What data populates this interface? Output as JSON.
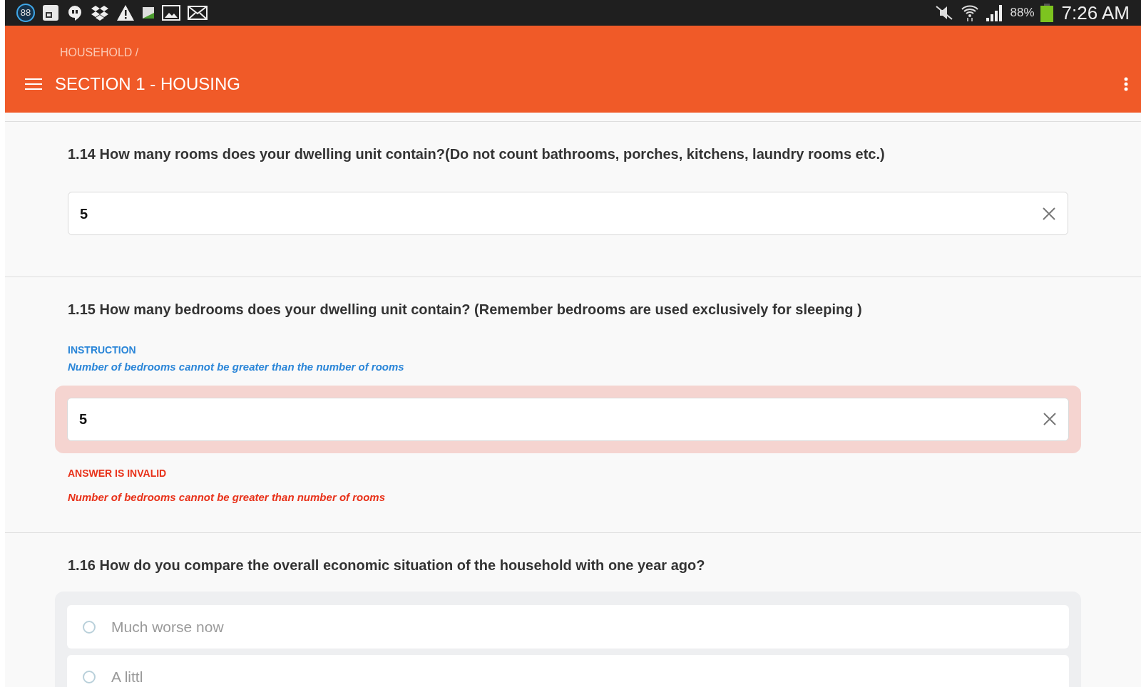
{
  "status_bar": {
    "badge": "88",
    "battery_text": "88%",
    "time": "7:26 AM"
  },
  "header": {
    "breadcrumb": "HOUSEHOLD /",
    "title": "SECTION 1 - HOUSING"
  },
  "questions": [
    {
      "kind": "text",
      "label": "1.14 How many rooms does your dwelling unit contain?(Do not count bathrooms, porches, kitchens, laundry rooms etc.)",
      "value": "5",
      "invalid": false
    },
    {
      "kind": "text",
      "label": "1.15 How many bedrooms does your dwelling unit contain? (Remember bedrooms are used exclusively for sleeping )",
      "instruction_title": "INSTRUCTION",
      "instruction": "Number of bedrooms cannot be greater than the number of rooms",
      "value": "5",
      "invalid": true,
      "error_title": "ANSWER IS INVALID",
      "error": "Number of bedrooms cannot be greater than number of rooms"
    },
    {
      "kind": "choice",
      "label": "1.16 How do you compare the overall economic situation of the household with one year ago?",
      "options": [
        {
          "label": "Much worse now",
          "selected": false
        },
        {
          "label": "A littl",
          "selected": false
        }
      ]
    }
  ]
}
